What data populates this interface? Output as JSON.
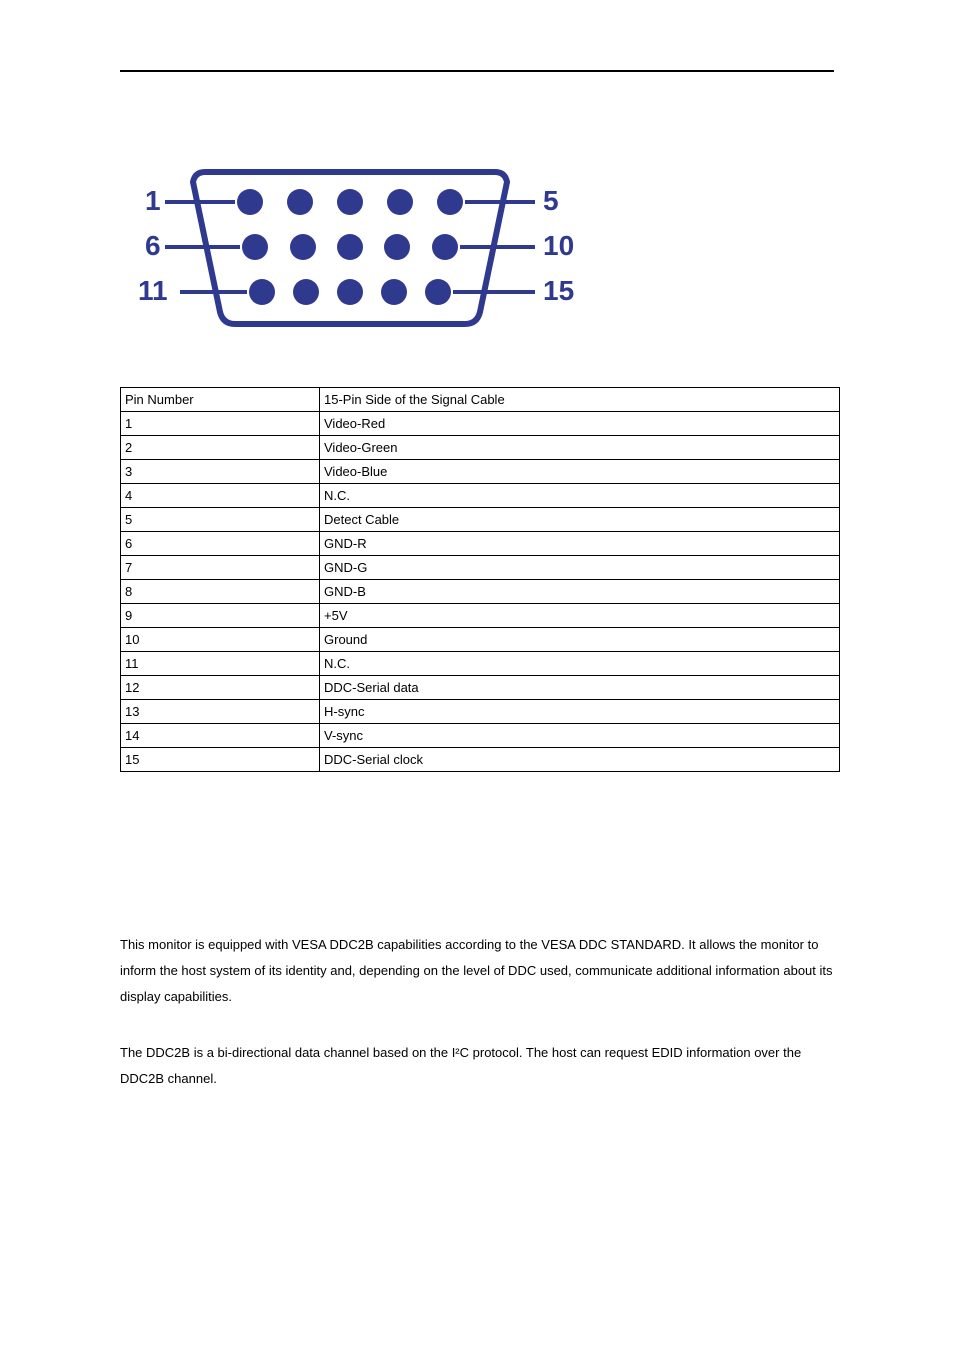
{
  "table": {
    "header": {
      "col1": "Pin Number",
      "col2": "15-Pin Side of the Signal Cable"
    },
    "rows": [
      {
        "num": "1",
        "desc": "Video-Red"
      },
      {
        "num": "2",
        "desc": "Video-Green"
      },
      {
        "num": "3",
        "desc": "Video-Blue"
      },
      {
        "num": "4",
        "desc": "N.C."
      },
      {
        "num": "5",
        "desc": "Detect Cable"
      },
      {
        "num": "6",
        "desc": "GND-R"
      },
      {
        "num": "7",
        "desc": "GND-G"
      },
      {
        "num": "8",
        "desc": "GND-B"
      },
      {
        "num": "9",
        "desc": "+5V"
      },
      {
        "num": "10",
        "desc": "Ground"
      },
      {
        "num": "11",
        "desc": "N.C."
      },
      {
        "num": "12",
        "desc": "DDC-Serial data"
      },
      {
        "num": "13",
        "desc": "H-sync"
      },
      {
        "num": "14",
        "desc": "V-sync"
      },
      {
        "num": "15",
        "desc": "DDC-Serial clock"
      }
    ]
  },
  "paragraphs": {
    "p1": "This monitor is equipped with VESA DDC2B capabilities according to the VESA DDC STANDARD. It allows the monitor to inform the host system of its identity and, depending on the level of DDC used, communicate additional information about its display capabilities.",
    "p2": "The DDC2B is a bi-directional data channel based on the I²C protocol. The host can request EDID information over the DDC2B channel."
  },
  "diagram": {
    "labels": {
      "l1": "1",
      "l2": "5",
      "l3": "6",
      "l4": "10",
      "l5": "11",
      "l6": "15"
    }
  }
}
